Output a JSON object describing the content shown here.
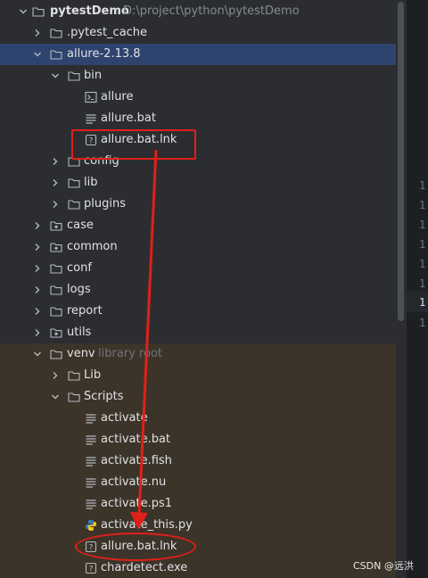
{
  "tree": {
    "root": {
      "label": "pytestDemo",
      "path": "D:\\project\\python\\pytestDemo"
    },
    "items": [
      {
        "label": ".pytest_cache",
        "icon": "folder-icon"
      },
      {
        "label": "allure-2.13.8",
        "icon": "folder-icon"
      },
      {
        "label": "bin",
        "icon": "folder-icon"
      },
      {
        "label": "allure",
        "icon": "terminal-file-icon"
      },
      {
        "label": "allure.bat",
        "icon": "text-file-icon"
      },
      {
        "label": "allure.bat.lnk",
        "icon": "unknown-file-icon"
      },
      {
        "label": "config",
        "icon": "folder-icon"
      },
      {
        "label": "lib",
        "icon": "folder-icon"
      },
      {
        "label": "plugins",
        "icon": "folder-icon"
      },
      {
        "label": "case",
        "icon": "package-folder-icon"
      },
      {
        "label": "common",
        "icon": "package-folder-icon"
      },
      {
        "label": "conf",
        "icon": "folder-icon"
      },
      {
        "label": "logs",
        "icon": "folder-icon"
      },
      {
        "label": "report",
        "icon": "folder-icon"
      },
      {
        "label": "utils",
        "icon": "package-folder-icon"
      },
      {
        "label": "venv",
        "icon": "folder-icon",
        "hint": "library root"
      },
      {
        "label": "Lib",
        "icon": "folder-icon"
      },
      {
        "label": "Scripts",
        "icon": "folder-icon"
      },
      {
        "label": "activate",
        "icon": "text-file-icon"
      },
      {
        "label": "activate.bat",
        "icon": "text-file-icon"
      },
      {
        "label": "activate.fish",
        "icon": "text-file-icon"
      },
      {
        "label": "activate.nu",
        "icon": "text-file-icon"
      },
      {
        "label": "activate.ps1",
        "icon": "text-file-icon"
      },
      {
        "label": "activate_this.py",
        "icon": "python-file-icon"
      },
      {
        "label": "allure.bat.lnk",
        "icon": "unknown-file-icon"
      },
      {
        "label": "chardetect.exe",
        "icon": "unknown-file-icon"
      }
    ]
  },
  "gutter": [
    "1",
    "1",
    "1",
    "1",
    "1",
    "1",
    "1",
    "1"
  ],
  "watermark": "CSDN @远洪",
  "colors": {
    "selection": "#2e436e",
    "annotation": "#e0201a",
    "venv_background": "#3c3429"
  }
}
